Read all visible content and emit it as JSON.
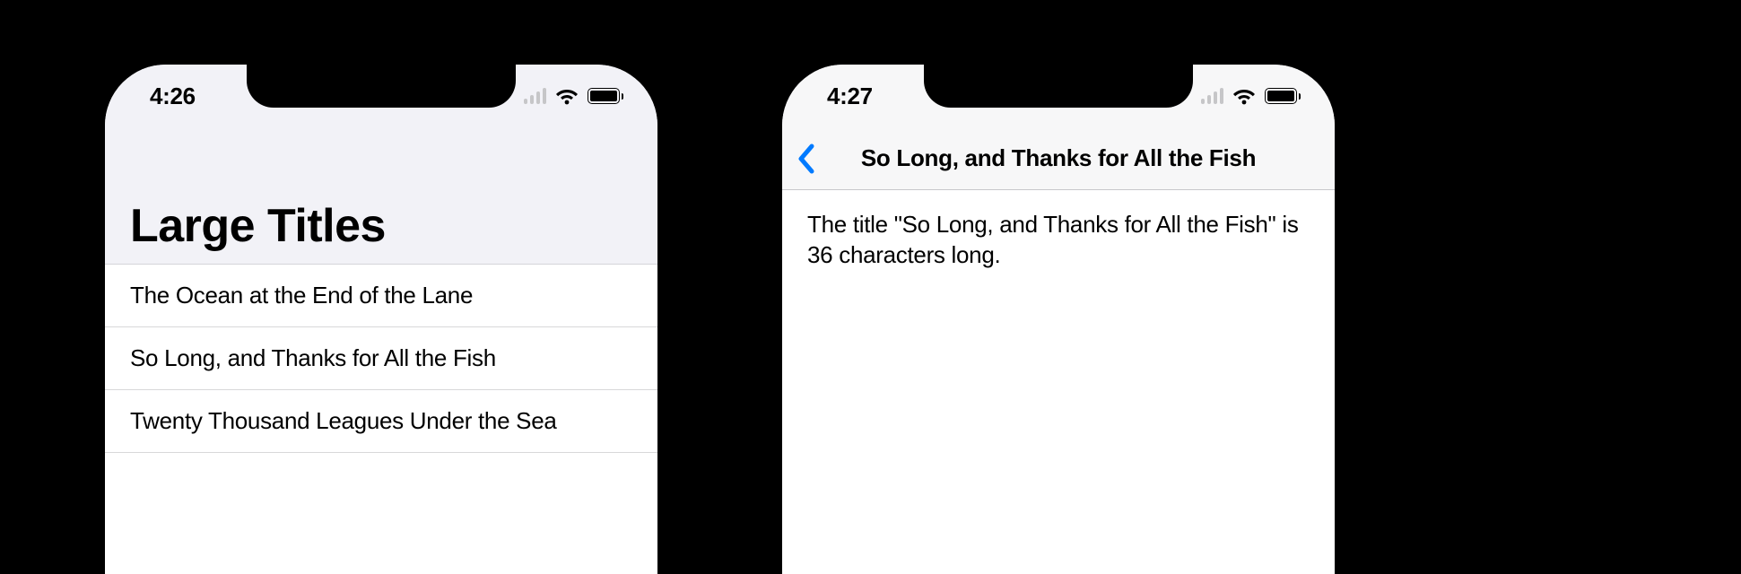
{
  "phones": {
    "left": {
      "status": {
        "time": "4:26"
      },
      "large_title": "Large Titles",
      "rows": [
        "The Ocean at the End of the Lane",
        "So Long, and Thanks for All the Fish",
        "Twenty Thousand Leagues Under the Sea"
      ]
    },
    "right": {
      "status": {
        "time": "4:27"
      },
      "nav_title": "So Long, and Thanks for All the Fish",
      "detail_text": "The title \"So Long, and Thanks for All the Fish\" is 36 characters long."
    }
  }
}
